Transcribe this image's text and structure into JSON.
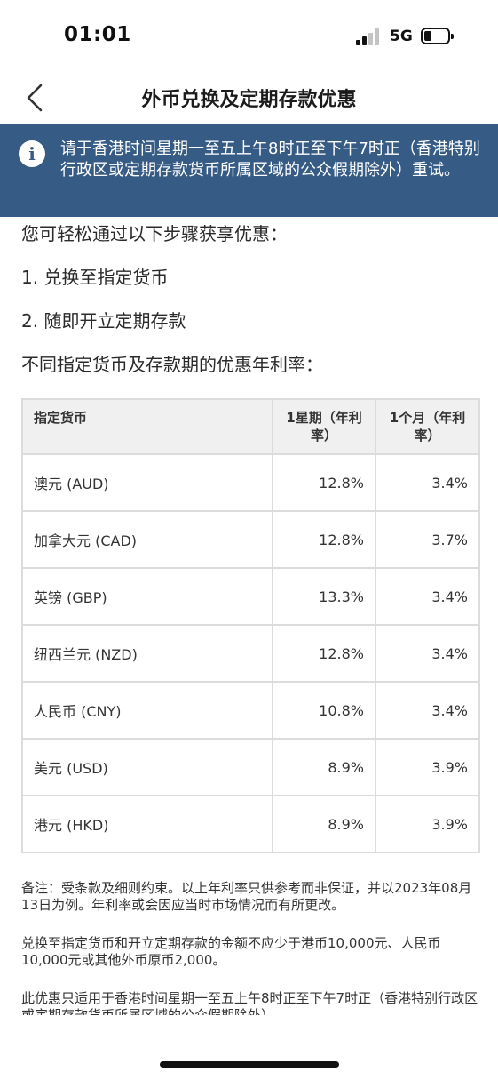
{
  "status_bar": {
    "time": "01:01",
    "network": "5G",
    "battery_level": 0.3
  },
  "header": {
    "title": "外币兑换及定期存款优惠"
  },
  "banner": {
    "text": "请于香港时间星期一至五上午8时正至下午7时正（香港特别行政区或定期存款货币所属区域的公众假期除外）重试。"
  },
  "content": {
    "intro": "您可轻松通过以下步骤获享优惠：",
    "steps": [
      "1. 兑换至指定货币",
      "2. 随即开立定期存款"
    ],
    "rates_heading": "不同指定货币及存款期的优惠年利率："
  },
  "table": {
    "headers": [
      "指定货币",
      "1星期（年利率）",
      "1个月（年利率）"
    ],
    "rows": [
      [
        "澳元 (AUD)",
        "12.8%",
        "3.4%"
      ],
      [
        "加拿大元 (CAD)",
        "12.8%",
        "3.7%"
      ],
      [
        "英镑 (GBP)",
        "13.3%",
        "3.4%"
      ],
      [
        "纽西兰元 (NZD)",
        "12.8%",
        "3.4%"
      ],
      [
        "人民币 (CNY)",
        "10.8%",
        "3.4%"
      ],
      [
        "美元 (USD)",
        "8.9%",
        "3.9%"
      ],
      [
        "港元 (HKD)",
        "8.9%",
        "3.9%"
      ]
    ]
  },
  "notes": [
    "备注：受条款及细则约束。以上年利率只供参考而非保证，并以2023年08月13日为例。年利率或会因应当时市场情况而有所更改。",
    "兑换至指定货币和开立定期存款的金额不应少于港币10,000元、人民币10,000元或其他外币原币2,000。",
    "此优惠只适用于香港时间星期一至五上午8时正至下午7时正（香港特别行政区或定期存款货币所属区域的公众假期除外）"
  ]
}
